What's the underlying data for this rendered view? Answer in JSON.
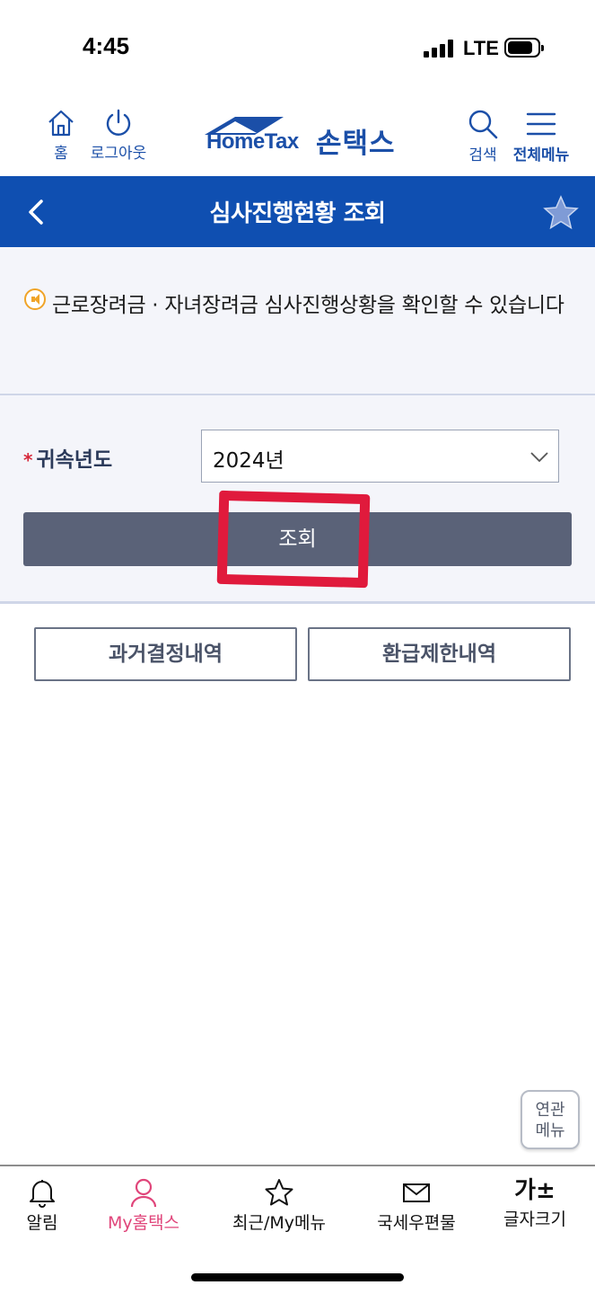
{
  "status_bar": {
    "time": "4:45",
    "network": "LTE"
  },
  "header": {
    "home_label": "홈",
    "logout_label": "로그아웃",
    "logo_en": "HomeTax",
    "logo_ko": "손택스",
    "search_label": "검색",
    "all_menu_label": "전체메뉴",
    "brand_color": "#1b4fa8"
  },
  "title_bar": {
    "title": "심사진행현황 조회",
    "color": "#0f4fb1"
  },
  "notice": {
    "text": "근로장려금 · 자녀장려금 심사진행상황을 확인할 수 있습니다"
  },
  "form": {
    "field_label": "귀속년도",
    "required_mark": "*",
    "selected_year": "2024년",
    "search_button": "조회"
  },
  "sub_buttons": [
    "과거결정내역",
    "환급제한내역"
  ],
  "related_menu": {
    "line1": "연관",
    "line2": "메뉴"
  },
  "bottom_nav": {
    "items": [
      {
        "label": "알림",
        "icon": "bell-icon"
      },
      {
        "label": "My홈택스",
        "icon": "person-icon",
        "active": true,
        "active_color": "#e0457a"
      },
      {
        "label": "최근/My메뉴",
        "icon": "star-icon"
      },
      {
        "label": "국세우편물",
        "icon": "mail-icon"
      },
      {
        "label": "글자크기",
        "icon": "font-size-icon",
        "glyph": "가±"
      }
    ]
  }
}
